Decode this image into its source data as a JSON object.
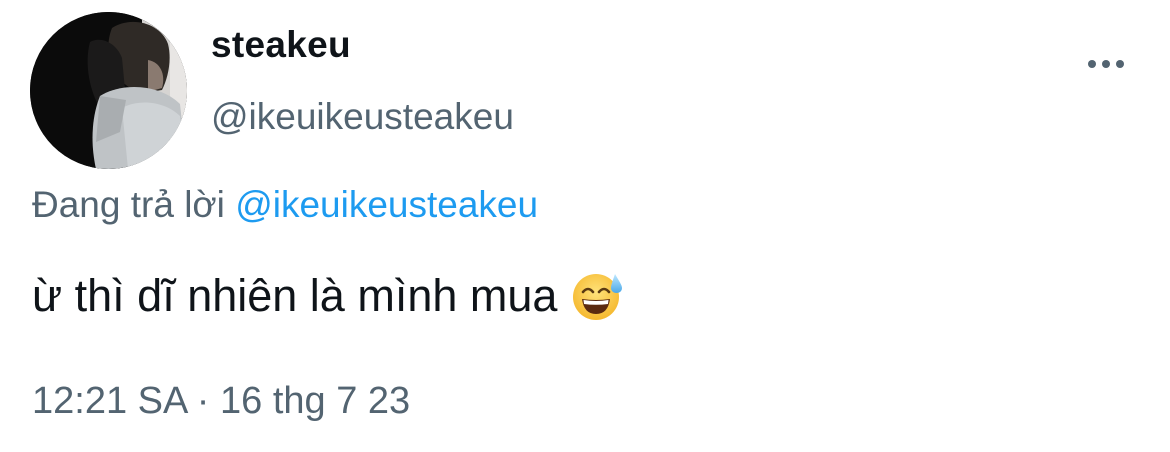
{
  "tweet": {
    "display_name": "steakeu",
    "handle": "@ikeuikeusteakeu",
    "more_icon": "more-horizontal-icon",
    "reply": {
      "prefix": "Đang trả lời",
      "mention": "@ikeuikeusteakeu"
    },
    "text": "ừ thì dĩ nhiên là mình mua",
    "emoji": "grinning-face-with-sweat-emoji",
    "timestamp": "12:21 SA · 16 thg 7 23"
  },
  "colors": {
    "text_primary": "#0f1419",
    "text_secondary": "#536471",
    "link": "#1d9bf0",
    "background": "#ffffff"
  }
}
